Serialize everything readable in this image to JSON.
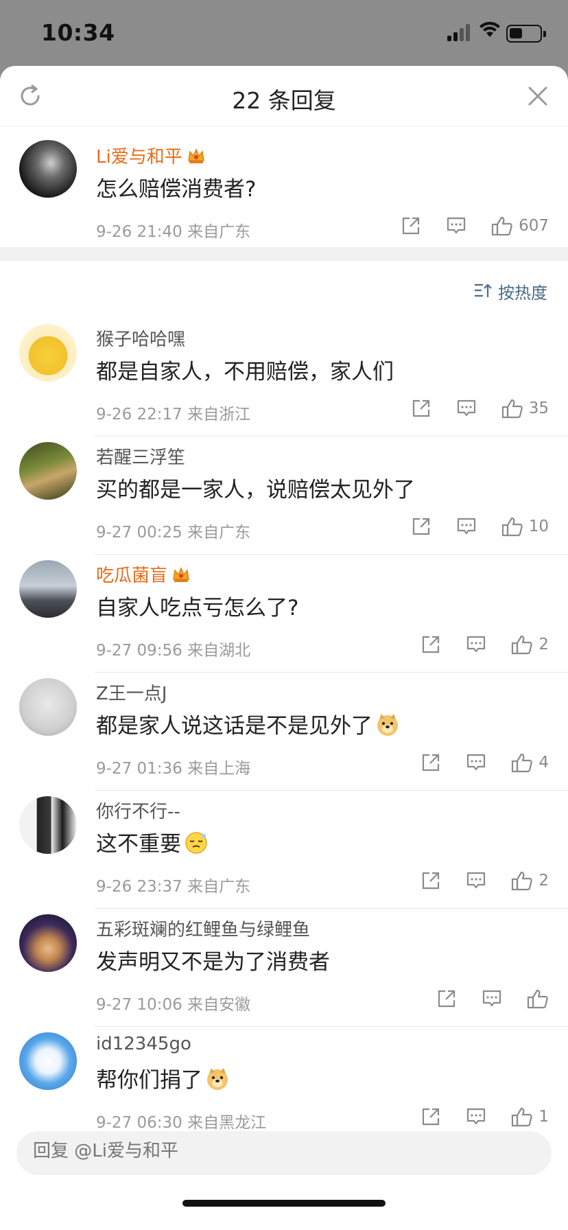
{
  "status": {
    "time": "10:34"
  },
  "header": {
    "title": "22 条回复"
  },
  "main_comment": {
    "user": "Li爱与和平",
    "vip": true,
    "text": "怎么赔偿消费者?",
    "meta": "9-26 21:40  来自广东",
    "likes": "607"
  },
  "sort": {
    "label": "按热度"
  },
  "replies": [
    {
      "user": "猴子哈哈嘿",
      "vip": false,
      "text": "都是自家人，不用赔偿，家人们",
      "meta": "9-26 22:17  来自浙江",
      "likes": "35",
      "avatar": "sponge"
    },
    {
      "user": "若醒三浮笙",
      "vip": false,
      "text": "买的都是一家人，说赔偿太见外了",
      "meta": "9-27 00:25  来自广东",
      "likes": "10",
      "avatar": "forest"
    },
    {
      "user": "吃瓜菌盲",
      "vip": true,
      "text": "自家人吃点亏怎么了?",
      "meta": "9-27 09:56  来自湖北",
      "likes": "2",
      "avatar": "mountain"
    },
    {
      "user": "Z王一点J",
      "vip": false,
      "text": "都是家人说这话是不是见外了",
      "meta": "9-27 01:36  来自上海",
      "likes": "4",
      "avatar": "ghost",
      "emoji": "doge"
    },
    {
      "user": "你行不行--",
      "vip": false,
      "text": "这不重要",
      "meta": "9-26 23:37  来自广东",
      "likes": "2",
      "avatar": "duo",
      "emoji": "sleepy"
    },
    {
      "user": "五彩斑斓的红鲤鱼与绿鲤鱼",
      "vip": false,
      "text": "发声明又不是为了消费者",
      "meta": "9-27 10:06  来自安徽",
      "likes": "",
      "avatar": "hand"
    },
    {
      "user": "id12345go",
      "vip": false,
      "text": "帮你们捐了",
      "meta": "9-27 06:30  来自黑龙江",
      "likes": "1",
      "avatar": "cloud",
      "emoji": "doge"
    }
  ],
  "reply_bar": {
    "placeholder": "回复 @Li爱与和平"
  },
  "colors": {
    "vip_name": "#e86c1a",
    "sort_link": "#4a6b8a",
    "meta": "#9a9a9a"
  },
  "icons": [
    "refresh-icon",
    "close-icon",
    "share-icon",
    "comment-icon",
    "like-icon",
    "sort-icon",
    "crown-icon"
  ]
}
